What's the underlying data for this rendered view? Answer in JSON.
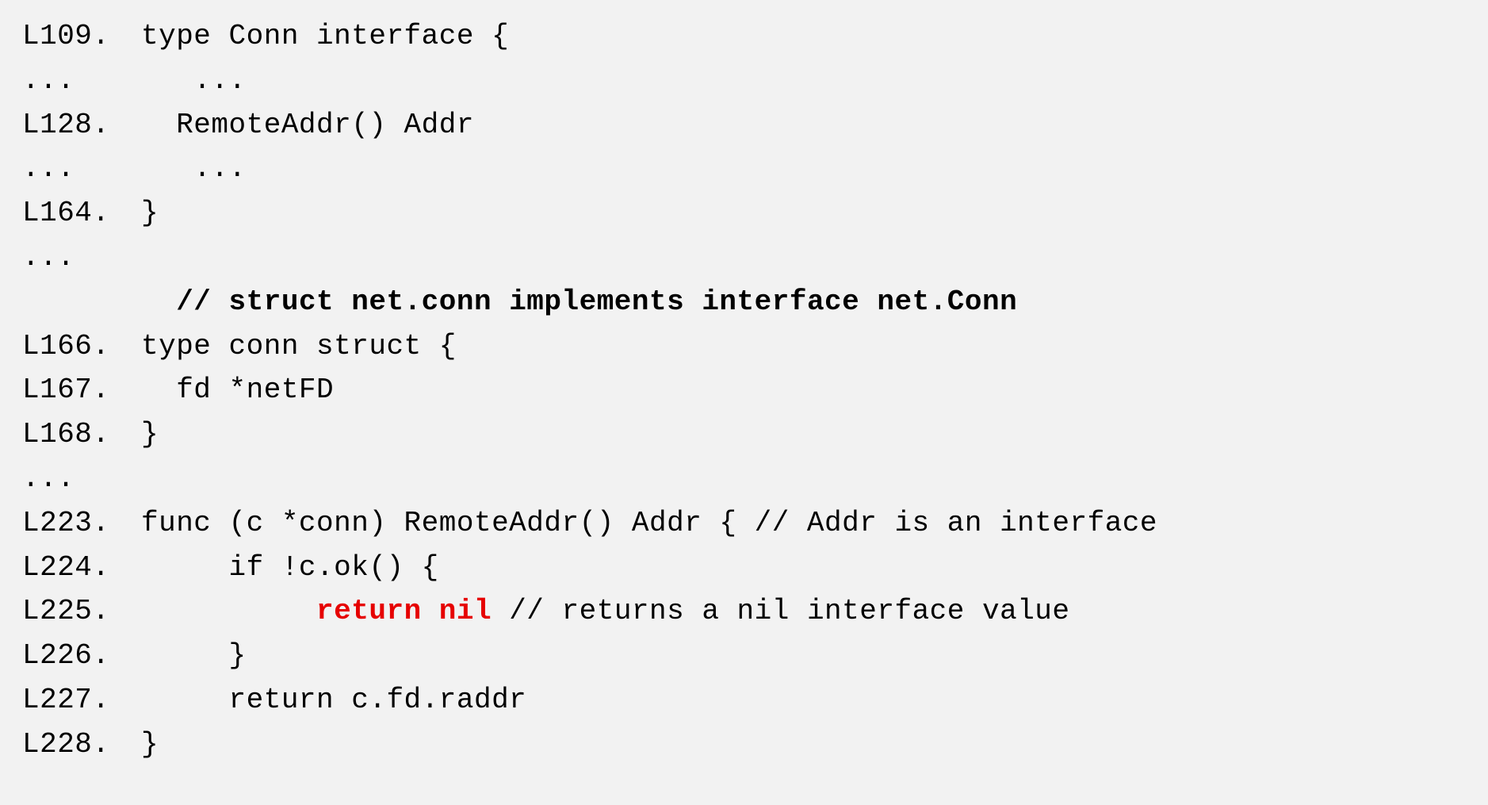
{
  "lines": [
    {
      "gutter": "L109.",
      "segments": [
        {
          "text": "type Conn interface {"
        }
      ]
    },
    {
      "gutter": "...",
      "segments": [
        {
          "text": "   ..."
        }
      ]
    },
    {
      "gutter": "L128.",
      "segments": [
        {
          "text": "  RemoteAddr() Addr"
        }
      ]
    },
    {
      "gutter": "...",
      "segments": [
        {
          "text": "   ..."
        }
      ]
    },
    {
      "gutter": "L164.",
      "segments": [
        {
          "text": "}"
        }
      ]
    },
    {
      "gutter": "...",
      "segments": [
        {
          "text": ""
        }
      ]
    },
    {
      "gutter": "",
      "segments": [
        {
          "text": "  // ",
          "class": "bold"
        },
        {
          "text": "struct net.conn implements interface net.Conn",
          "class": "bold"
        }
      ]
    },
    {
      "gutter": "L166.",
      "segments": [
        {
          "text": "type conn struct {"
        }
      ]
    },
    {
      "gutter": "L167.",
      "segments": [
        {
          "text": "  fd *netFD"
        }
      ]
    },
    {
      "gutter": "L168.",
      "segments": [
        {
          "text": "}"
        }
      ]
    },
    {
      "gutter": "...",
      "segments": [
        {
          "text": ""
        }
      ]
    },
    {
      "gutter": "L223.",
      "segments": [
        {
          "text": "func (c *conn) RemoteAddr() Addr { // Addr is an interface"
        }
      ]
    },
    {
      "gutter": "L224.",
      "segments": [
        {
          "text": "     if !c.ok() {"
        }
      ]
    },
    {
      "gutter": "L225.",
      "segments": [
        {
          "text": "          "
        },
        {
          "text": "return nil",
          "class": "red"
        },
        {
          "text": " // returns a nil interface value"
        }
      ]
    },
    {
      "gutter": "L226.",
      "segments": [
        {
          "text": "     }"
        }
      ]
    },
    {
      "gutter": "L227.",
      "segments": [
        {
          "text": "     return c.fd.raddr"
        }
      ]
    },
    {
      "gutter": "L228.",
      "segments": [
        {
          "text": "}"
        }
      ]
    }
  ]
}
